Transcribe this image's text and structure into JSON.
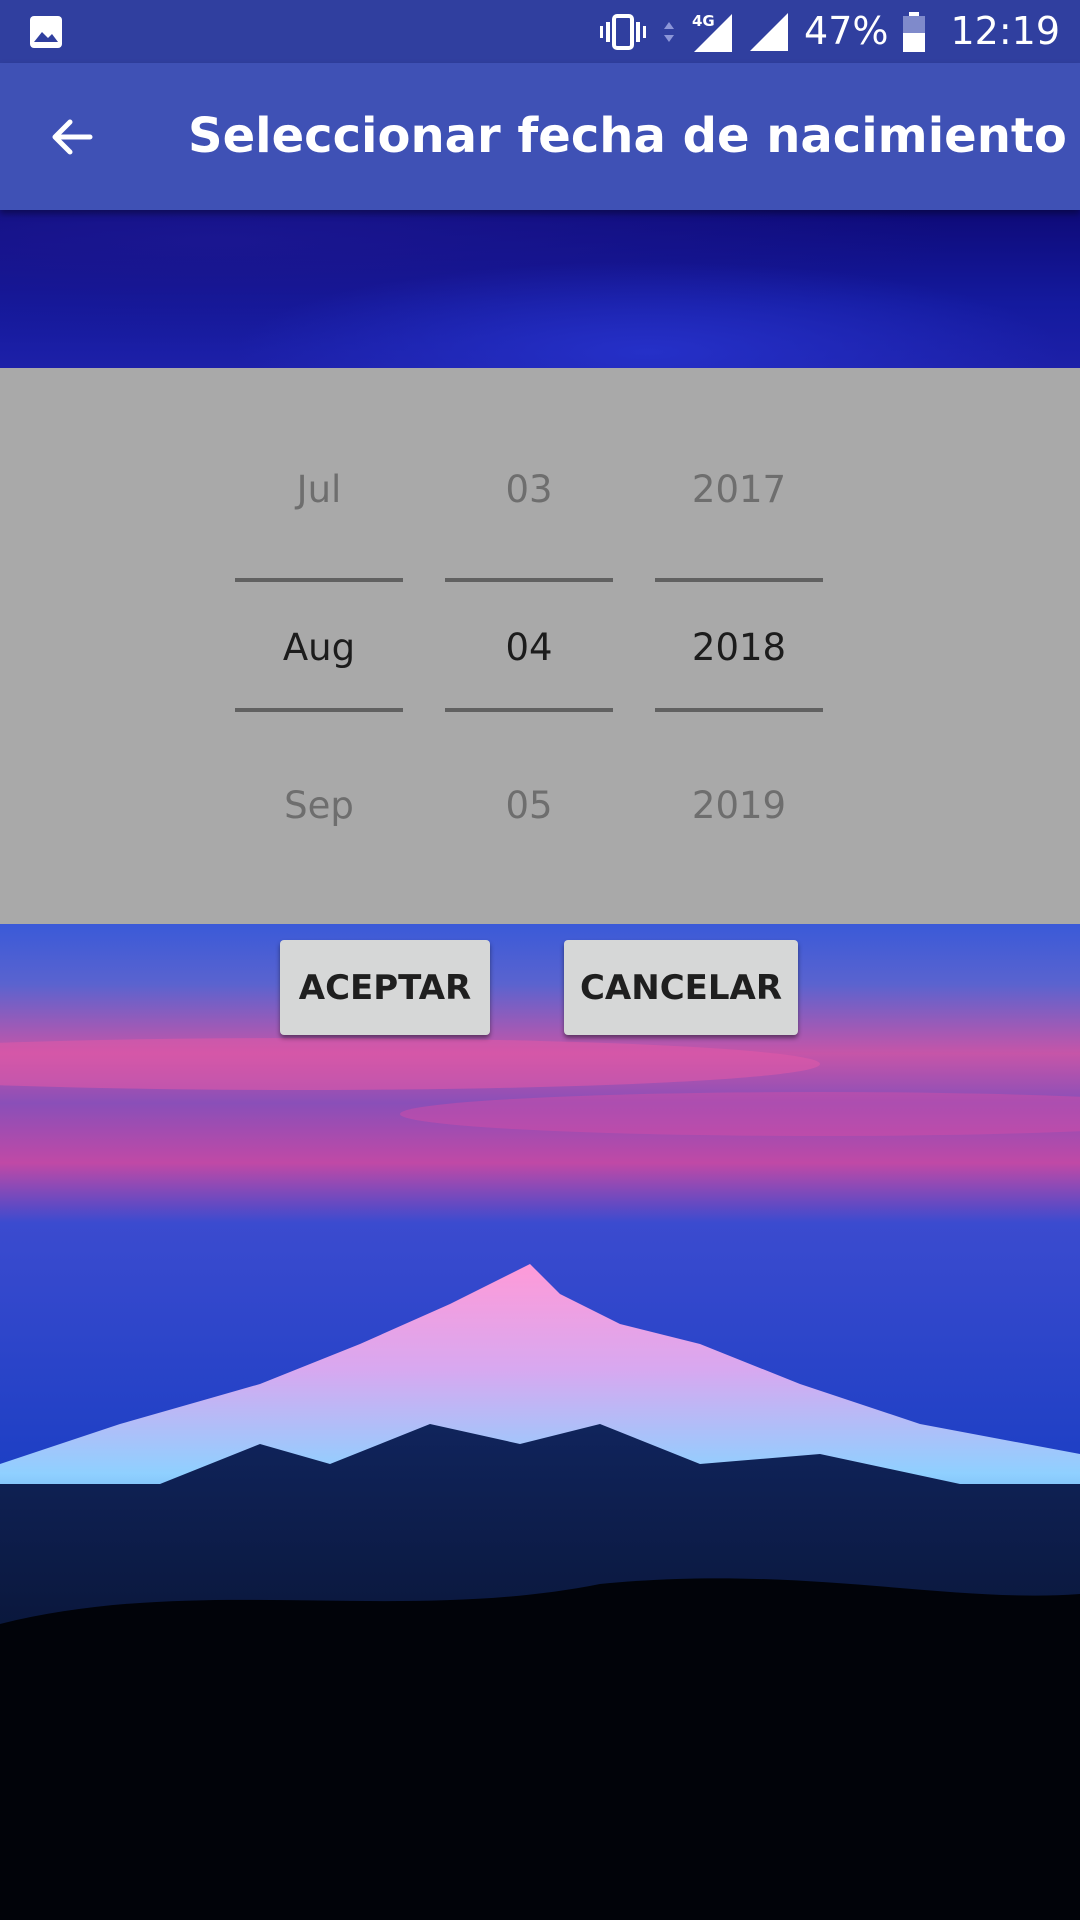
{
  "status_bar": {
    "battery_percent": "47%",
    "time": "12:19",
    "network_label": "4G",
    "icons": [
      "image-icon",
      "vibrate-icon",
      "data-arrows-icon",
      "signal-4g-icon",
      "signal-icon",
      "battery-icon"
    ]
  },
  "app_bar": {
    "title": "Seleccionar fecha de nacimiento",
    "back_icon": "arrow-back-icon"
  },
  "picker": {
    "month": {
      "prev": "Jul",
      "selected": "Aug",
      "next": "Sep"
    },
    "day": {
      "prev": "03",
      "selected": "04",
      "next": "05"
    },
    "year": {
      "prev": "2017",
      "selected": "2018",
      "next": "2019"
    }
  },
  "buttons": {
    "accept": "ACEPTAR",
    "cancel": "CANCELAR"
  },
  "colors": {
    "status_bar": "#303f9f",
    "app_bar": "#3f51b5",
    "picker_panel": "#a9a9a9",
    "button_bg": "#d6d7d7"
  }
}
